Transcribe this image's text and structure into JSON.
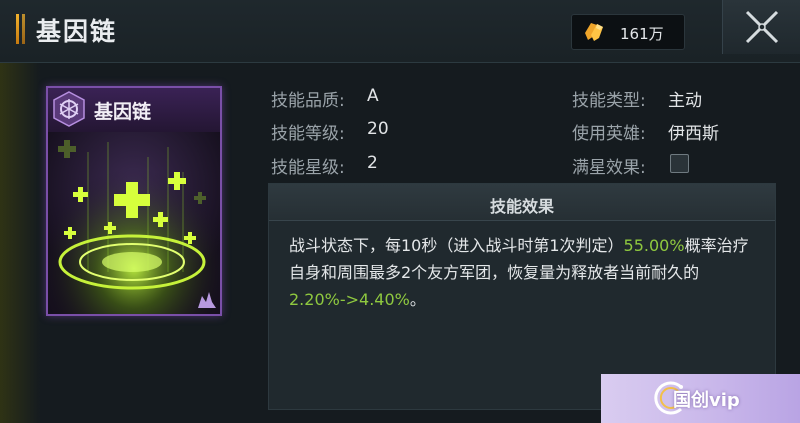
{
  "header": {
    "title": "基因链",
    "currency": {
      "icon": "crystal-icon",
      "value": "161万"
    },
    "close_icon": "close-icon"
  },
  "card": {
    "title": "基因链",
    "badge_icon": "skill-emblem-icon",
    "art": "green-heal-crosses-art",
    "frame_color": "#7a4fa8"
  },
  "info": {
    "quality_label": "技能品质:",
    "quality_value": "A",
    "level_label": "技能等级:",
    "level_value": "20",
    "star_label": "技能星级:",
    "star_value": "2",
    "type_label": "技能类型:",
    "type_value": "主动",
    "hero_label": "使用英雄:",
    "hero_value": "伊西斯",
    "maxstar_label": "满星效果:",
    "maxstar_checked": false
  },
  "effect": {
    "title": "技能效果",
    "text_before": "战斗状态下，每10秒（进入战斗时第1次判定）",
    "highlight1": "55.00%",
    "text_middle": "概率治疗自身和周围最多2个友方军团，恢复量为释放者当前耐久的",
    "highlight2": "2.20%->4.40%",
    "text_after": "。",
    "highlight_color": "#8fc93f"
  },
  "watermark": {
    "text": "国创vip"
  }
}
